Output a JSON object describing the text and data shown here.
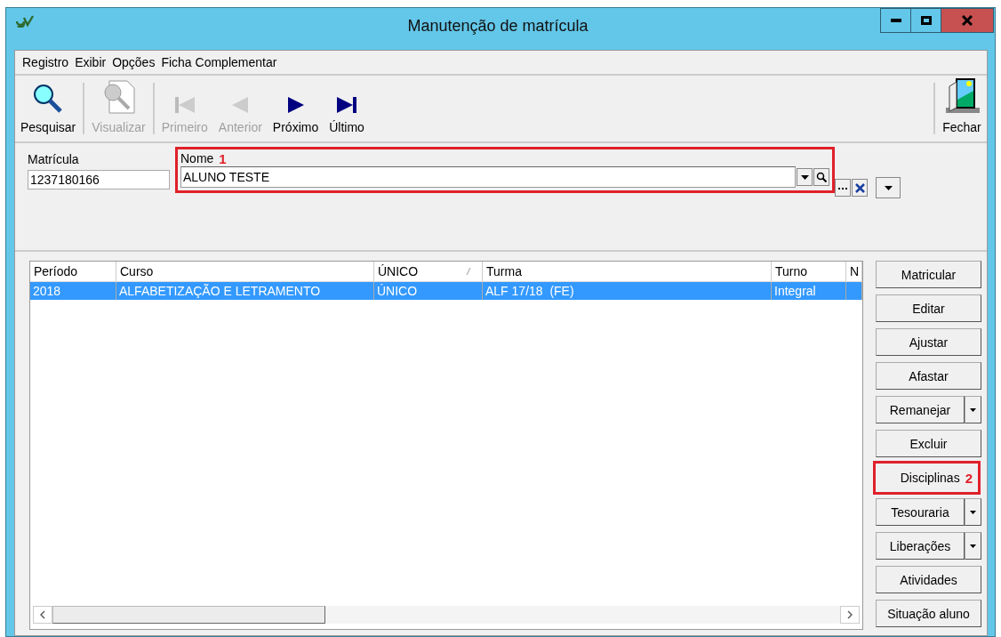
{
  "window": {
    "title": "Manutenção de matrícula",
    "controls": [
      {
        "kind": "minimize"
      },
      {
        "kind": "maximize"
      },
      {
        "kind": "close"
      }
    ]
  },
  "menu": [
    "Registro",
    "Exibir",
    "Opções",
    "Ficha Complementar"
  ],
  "toolbar": [
    {
      "kind": "search",
      "label": "Pesquisar",
      "disabled": false
    },
    {
      "kind": "view",
      "label": "Visualizar",
      "disabled": true
    },
    {
      "kind": "first",
      "label": "Primeiro",
      "disabled": true
    },
    {
      "kind": "prev",
      "label": "Anterior",
      "disabled": true
    },
    {
      "kind": "next",
      "label": "Próximo",
      "disabled": false
    },
    {
      "kind": "last",
      "label": "Último",
      "disabled": false
    },
    {
      "kind": "exit",
      "label": "Fechar",
      "disabled": false
    }
  ],
  "form": {
    "matricula": {
      "label": "Matrícula",
      "value": "1237180166"
    },
    "nome": {
      "label": "Nome",
      "marker": "1",
      "value": "ALUNO TESTE"
    }
  },
  "table": {
    "columns": [
      {
        "label": "Período",
        "sort": false
      },
      {
        "label": "Curso",
        "sort": false
      },
      {
        "label": "ÚNICO",
        "sort": true
      },
      {
        "label": "Turma",
        "sort": false
      },
      {
        "label": "Turno",
        "sort": false
      },
      {
        "label": "N",
        "sort": false
      }
    ],
    "rows": [
      {
        "selected": true,
        "cells": [
          "2018",
          "ALFABETIZAÇÃO E LETRAMENTO",
          "ÚNICO",
          "ALF 17/18  (FE)",
          "Integral",
          ""
        ]
      }
    ]
  },
  "actions": [
    {
      "label": "Matricular",
      "dropdown": false
    },
    {
      "label": "Editar",
      "dropdown": false
    },
    {
      "label": "Ajustar",
      "dropdown": false
    },
    {
      "label": "Afastar",
      "dropdown": false
    },
    {
      "label": "Remanejar",
      "dropdown": true
    },
    {
      "label": "Excluir",
      "dropdown": false
    },
    {
      "label": "Disciplinas",
      "dropdown": false,
      "marker": "2"
    },
    {
      "label": "Tesouraria",
      "dropdown": true
    },
    {
      "label": "Liberações",
      "dropdown": true
    },
    {
      "label": "Atividades",
      "dropdown": false
    },
    {
      "label": "Situação aluno",
      "dropdown": false
    }
  ]
}
